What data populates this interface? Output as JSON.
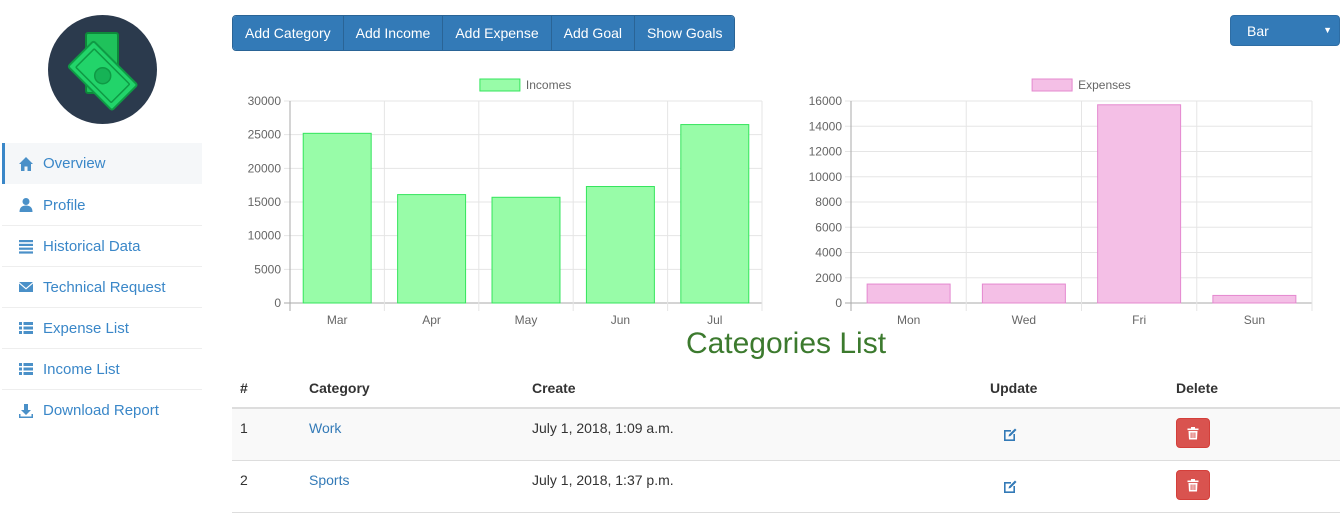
{
  "sidebar": {
    "items": [
      {
        "label": "Overview",
        "icon": "home-icon",
        "active": true
      },
      {
        "label": "Profile",
        "icon": "user-icon"
      },
      {
        "label": "Historical Data",
        "icon": "list-icon"
      },
      {
        "label": "Technical Request",
        "icon": "envelope-icon"
      },
      {
        "label": "Expense List",
        "icon": "th-list-icon"
      },
      {
        "label": "Income List",
        "icon": "th-list-icon"
      },
      {
        "label": "Download Report",
        "icon": "download-icon"
      }
    ]
  },
  "toolbar": {
    "buttons": [
      "Add Category",
      "Add Income",
      "Add Expense",
      "Add Goal",
      "Show Goals"
    ],
    "chart_type": "Bar"
  },
  "colors": {
    "primary": "#337ab7",
    "income_fill": "#98fca8",
    "income_border": "#34e55c",
    "expense_fill": "#f4bfe6",
    "expense_border": "#e488cf",
    "danger": "#d9534f",
    "title_green": "#3c7a2e"
  },
  "chart_data": [
    {
      "type": "bar",
      "legend": "Incomes",
      "categories": [
        "Mar",
        "Apr",
        "May",
        "Jun",
        "Jul"
      ],
      "values": [
        25200,
        16100,
        15700,
        17300,
        26500
      ],
      "ylim": [
        0,
        30000
      ],
      "yticks": [
        0,
        5000,
        10000,
        15000,
        20000,
        25000,
        30000
      ],
      "grid": true,
      "legend_position": "top"
    },
    {
      "type": "bar",
      "legend": "Expenses",
      "categories": [
        "Mon",
        "Wed",
        "Fri",
        "Sun"
      ],
      "values": [
        1500,
        1500,
        15700,
        600
      ],
      "ylim": [
        0,
        16000
      ],
      "yticks": [
        0,
        2000,
        4000,
        6000,
        8000,
        10000,
        12000,
        14000,
        16000
      ],
      "grid": true,
      "legend_position": "top"
    }
  ],
  "categories_list": {
    "title": "Categories List",
    "headers": [
      "#",
      "Category",
      "Create",
      "Update",
      "Delete"
    ],
    "rows": [
      {
        "num": "1",
        "category": "Work",
        "created": "July 1, 2018, 1:09 a.m."
      },
      {
        "num": "2",
        "category": "Sports",
        "created": "July 1, 2018, 1:37 p.m."
      }
    ]
  }
}
